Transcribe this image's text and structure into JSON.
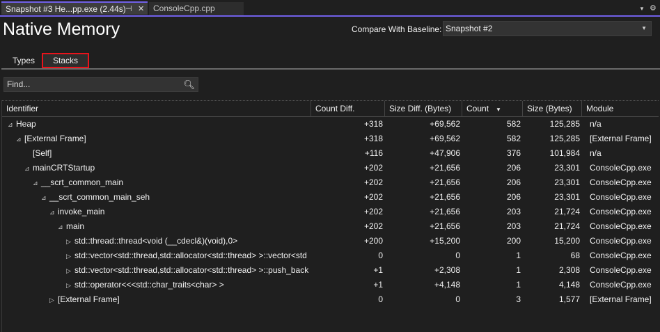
{
  "document_tabs": [
    {
      "label": "Snapshot #3 He...pp.exe (2.44s)",
      "active": true
    },
    {
      "label": "ConsoleCpp.cpp",
      "active": false
    }
  ],
  "icons": {
    "pin": "pin-icon",
    "close": "close-icon",
    "dropdown": "chevron-down-icon",
    "settings": "gear-icon",
    "search": "search-icon"
  },
  "accent_color": "#7160e8",
  "page_title": "Native Memory",
  "baseline": {
    "label": "Compare With Baseline:",
    "value": "Snapshot #2"
  },
  "view_tabs": [
    {
      "label": "Types"
    },
    {
      "label": "Stacks",
      "selected": true
    }
  ],
  "find": {
    "placeholder": "Find..."
  },
  "columns": [
    "Identifier",
    "Count Diff.",
    "Size Diff. (Bytes)",
    "Count",
    "Size (Bytes)",
    "Module"
  ],
  "sort_column": "Count",
  "rows": [
    {
      "level": 0,
      "expanded": true,
      "id": "Heap",
      "count_diff": "+318",
      "size_diff": "+69,562",
      "count": "582",
      "size": "125,285",
      "module": "n/a"
    },
    {
      "level": 1,
      "expanded": true,
      "id": "[External Frame]",
      "count_diff": "+318",
      "size_diff": "+69,562",
      "count": "582",
      "size": "125,285",
      "module": "[External Frame]"
    },
    {
      "level": 2,
      "expanded": null,
      "id": "[Self]",
      "count_diff": "+116",
      "size_diff": "+47,906",
      "count": "376",
      "size": "101,984",
      "module": "n/a"
    },
    {
      "level": 2,
      "expanded": true,
      "id": "mainCRTStartup",
      "count_diff": "+202",
      "size_diff": "+21,656",
      "count": "206",
      "size": "23,301",
      "module": "ConsoleCpp.exe"
    },
    {
      "level": 3,
      "expanded": true,
      "id": "__scrt_common_main",
      "count_diff": "+202",
      "size_diff": "+21,656",
      "count": "206",
      "size": "23,301",
      "module": "ConsoleCpp.exe"
    },
    {
      "level": 4,
      "expanded": true,
      "id": "__scrt_common_main_seh",
      "count_diff": "+202",
      "size_diff": "+21,656",
      "count": "206",
      "size": "23,301",
      "module": "ConsoleCpp.exe"
    },
    {
      "level": 5,
      "expanded": true,
      "id": "invoke_main",
      "count_diff": "+202",
      "size_diff": "+21,656",
      "count": "203",
      "size": "21,724",
      "module": "ConsoleCpp.exe"
    },
    {
      "level": 6,
      "expanded": true,
      "id": "main",
      "count_diff": "+202",
      "size_diff": "+21,656",
      "count": "203",
      "size": "21,724",
      "module": "ConsoleCpp.exe"
    },
    {
      "level": 7,
      "expanded": false,
      "id": "std::thread::thread<void (__cdecl&)(void),0>",
      "count_diff": "+200",
      "size_diff": "+15,200",
      "count": "200",
      "size": "15,200",
      "module": "ConsoleCpp.exe"
    },
    {
      "level": 7,
      "expanded": false,
      "id": "std::vector<std::thread,std::allocator<std::thread> >::vector<std",
      "count_diff": "0",
      "size_diff": "0",
      "count": "1",
      "size": "68",
      "module": "ConsoleCpp.exe"
    },
    {
      "level": 7,
      "expanded": false,
      "id": "std::vector<std::thread,std::allocator<std::thread> >::push_back",
      "count_diff": "+1",
      "size_diff": "+2,308",
      "count": "1",
      "size": "2,308",
      "module": "ConsoleCpp.exe"
    },
    {
      "level": 7,
      "expanded": false,
      "id": "std::operator<<<std::char_traits<char> >",
      "count_diff": "+1",
      "size_diff": "+4,148",
      "count": "1",
      "size": "4,148",
      "module": "ConsoleCpp.exe"
    },
    {
      "level": 5,
      "expanded": false,
      "id": "[External Frame]",
      "count_diff": "0",
      "size_diff": "0",
      "count": "3",
      "size": "1,577",
      "module": "[External Frame]"
    }
  ]
}
